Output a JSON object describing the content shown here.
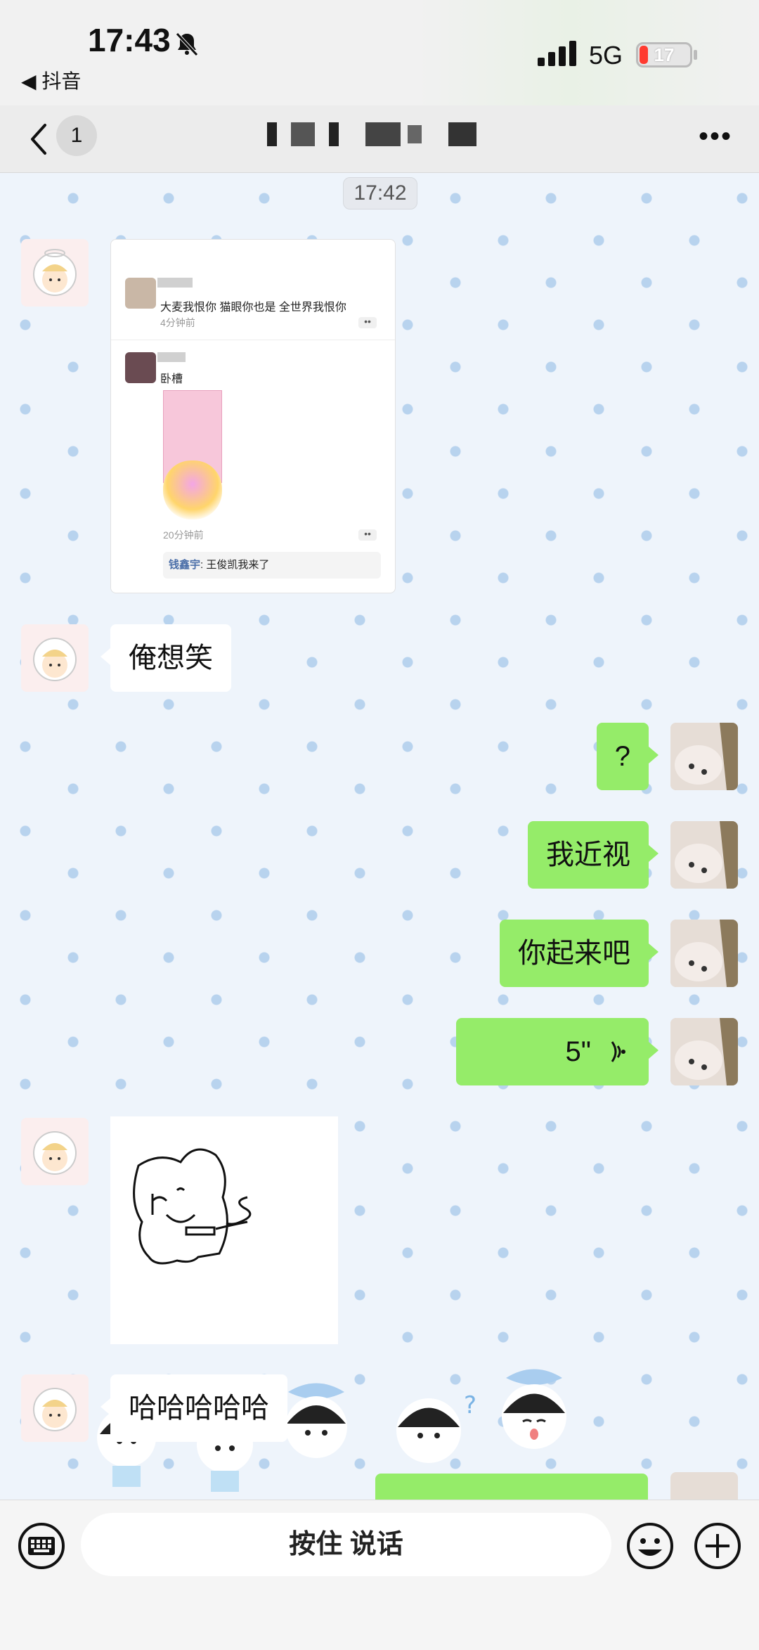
{
  "status": {
    "time": "17:43",
    "back_app": "◀ 抖音",
    "network": "5G",
    "battery": "17"
  },
  "nav": {
    "unread_count": "1"
  },
  "chat": {
    "timestamp": "17:42",
    "shared_card": {
      "comment1_text": "大麦我恨你 猫眼你也是 全世界我恨你",
      "comment1_time": "4分钟前",
      "comment2_text": "卧槽",
      "comment2_time": "20分钟前",
      "reply_author": "钱鑫宇",
      "reply_text": ": 王俊凯我来了"
    },
    "messages": [
      {
        "side": "left",
        "text": "俺想笑"
      },
      {
        "side": "right",
        "text": "?"
      },
      {
        "side": "right",
        "text": "我近视"
      },
      {
        "side": "right",
        "text": "你起来吧"
      },
      {
        "side": "right",
        "text": "5\""
      },
      {
        "side": "left",
        "text": "哈哈哈哈哈"
      }
    ]
  },
  "input": {
    "hold_to_talk": "按住 说话"
  },
  "icons": [
    "bell-mute-icon",
    "signal-icon",
    "back-icon",
    "more-icon",
    "keyboard-icon",
    "emoji-icon",
    "plus-icon",
    "voice-wave-icon"
  ]
}
